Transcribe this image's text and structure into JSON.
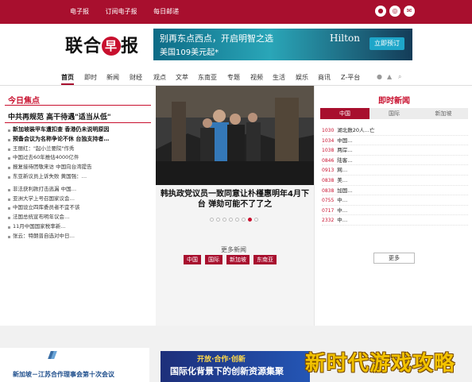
{
  "topbar": {
    "links": [
      "电子报",
      "订阅电子报",
      "每日邮递"
    ],
    "icons": [
      "weibo-icon",
      "wechat-icon",
      "mail-icon"
    ]
  },
  "header": {
    "logo": {
      "left": "联合",
      "mark": "早",
      "right": "报"
    },
    "ad": {
      "headline": "别再东点西点，开启明智之选",
      "sub": "美国109美元起*",
      "brand": "Hilton",
      "cta": "立即预订"
    }
  },
  "nav": {
    "items": [
      "首页",
      "即时",
      "新闻",
      "财经",
      "观点",
      "文萃",
      "东南亚",
      "专题",
      "视频",
      "生活",
      "娱乐",
      "商讯",
      "Z-平台"
    ],
    "active": "首页"
  },
  "left": {
    "section_title": "今日焦点",
    "lead": "中共再规范 高干待遇\"适当从低\"",
    "items": [
      {
        "text": "新加坡装甲车遭扣查 香港仍未说明原因",
        "bold": true
      },
      {
        "text": "预备会议为名称争论不休 台独支持者…",
        "bold": true
      },
      {
        "text": "王丽红：\"起小兰要院\"作秀",
        "bold": false
      },
      {
        "text": "中国过去60年推估4000亿件",
        "bold": false
      },
      {
        "text": "报复接待团敬来访 中国向台湾提告",
        "bold": false
      },
      {
        "text": "东亚新议员上诉失败 黄国强：…",
        "bold": false
      },
      {
        "text": "",
        "bold": false
      },
      {
        "text": "非法获利款打击逃漏 中国…",
        "bold": false
      },
      {
        "text": "亚洲大学上号召国家议会…",
        "bold": false
      },
      {
        "text": "中国设立四库委员者不宜不该",
        "bold": false
      },
      {
        "text": "法国总统宣布明年议会…",
        "bold": false
      },
      {
        "text": "11月中国国家税率新…",
        "bold": false
      },
      {
        "text": "张云：特朗普自选对中日…",
        "bold": false
      }
    ]
  },
  "center": {
    "caption": "韩执政党议员一致同意让朴槿惠明年4月下台 弹劾可能不了了之",
    "dots": 8,
    "active_dot": 7,
    "more_label": "更多新闻",
    "buttons": [
      "中国",
      "国际",
      "新加坡",
      "东南亚"
    ]
  },
  "right": {
    "title": "即时新闻",
    "tabs": [
      "中国",
      "国际",
      "新加坡"
    ],
    "active_tab": "中国",
    "items": [
      {
        "time": "1030",
        "text": "湖北数20人…亡"
      },
      {
        "time": "1034",
        "text": "中国…"
      },
      {
        "time": "1038",
        "text": "两岸…"
      },
      {
        "time": "0846",
        "text": "陆客…"
      },
      {
        "time": "0913",
        "text": "网…"
      },
      {
        "time": "0838",
        "text": "美…"
      },
      {
        "time": "0838",
        "text": "加国…"
      },
      {
        "time": "0755",
        "text": "中…"
      },
      {
        "time": "0717",
        "text": "中…"
      },
      {
        "time": "2332",
        "text": "中…"
      }
    ],
    "more_button": "更多"
  },
  "bottom": {
    "banner1": "新加坡－江苏合作理事会第十次会议",
    "banner2_line1": "开放·合作·创新",
    "banner2_line2": "国际化背景下的创新资源集聚"
  },
  "watermark": "新时代游戏攻略",
  "colors": {
    "brand": "#a80f2e",
    "accent": "#c8102e"
  }
}
